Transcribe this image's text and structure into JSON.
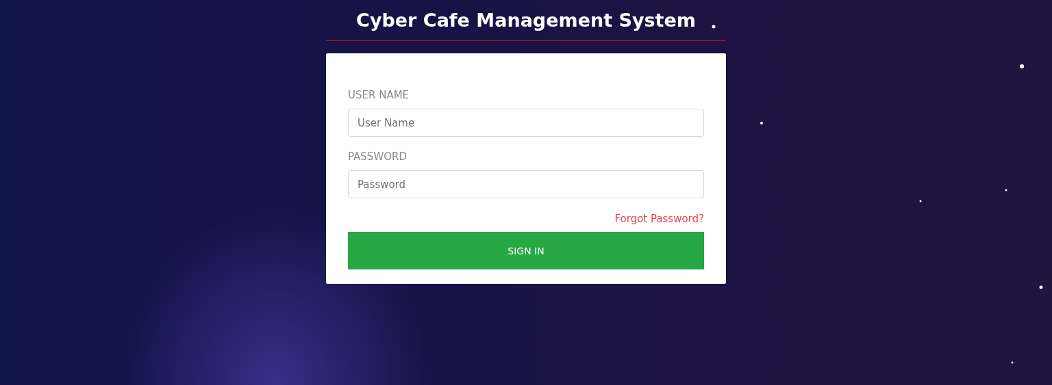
{
  "title": "Cyber Cafe Management System",
  "form": {
    "fields": [
      {
        "label": "USER NAME",
        "placeholder": "User Name"
      },
      {
        "label": "PASSWORD",
        "placeholder": "Password"
      }
    ],
    "forgot_link": "Forgot Password?",
    "submit": "SIGN IN"
  }
}
